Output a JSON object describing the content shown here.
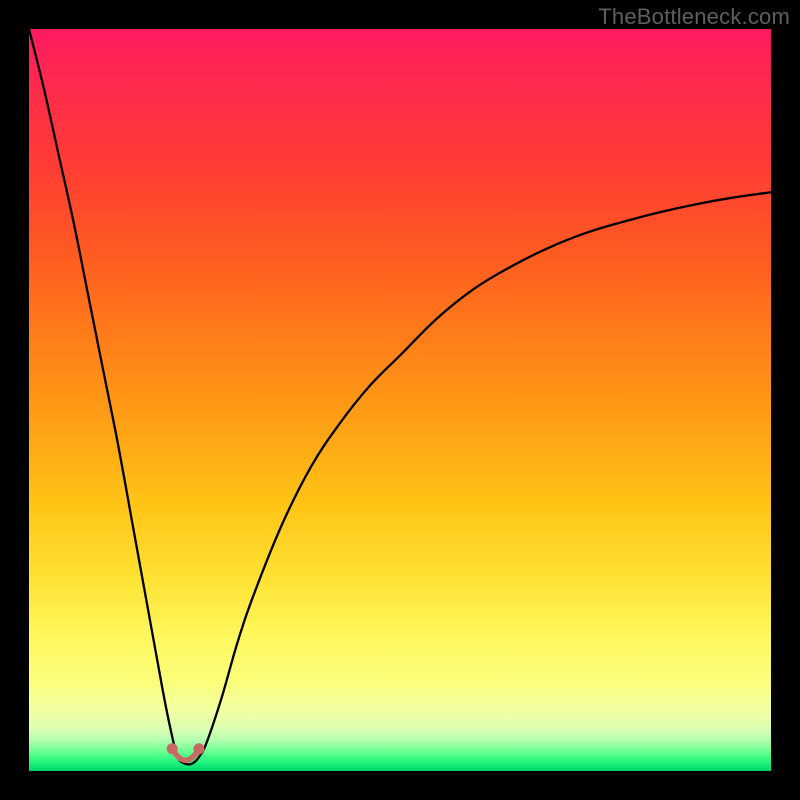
{
  "attribution": "TheBottleneck.com",
  "colors": {
    "frame": "#000000",
    "curve": "#000000",
    "bump": "#c86a63",
    "gradient_top": "#ff1a61",
    "gradient_bottom": "#00d46a"
  },
  "chart_data": {
    "type": "line",
    "title": "",
    "xlabel": "",
    "ylabel": "",
    "xlim": [
      0,
      100
    ],
    "ylim": [
      0,
      100
    ],
    "notes": "Bottleneck-style curve. y is bottleneck percentage (0 = green/good, 100 = red/bad). x is a normalized hardware-balance axis. Minimum (~0) occurs near x≈21 and the curve rises steeply on both sides, asymptoting near 100 on the left edge and ~78 on the right edge.",
    "series": [
      {
        "name": "bottleneck-curve",
        "x": [
          0,
          2,
          4,
          6,
          8,
          10,
          12,
          14,
          16,
          18,
          19,
          20,
          21,
          22,
          23,
          24,
          26,
          28,
          30,
          34,
          38,
          42,
          46,
          50,
          55,
          60,
          65,
          70,
          75,
          80,
          85,
          90,
          95,
          100
        ],
        "values": [
          100,
          92,
          83,
          74,
          64,
          54,
          44,
          33,
          22,
          11,
          6,
          2,
          1,
          1,
          2,
          4,
          10,
          17,
          23,
          33,
          41,
          47,
          52,
          56,
          61,
          65,
          68,
          70.5,
          72.5,
          74,
          75.3,
          76.4,
          77.3,
          78
        ]
      }
    ],
    "bump": {
      "note": "small salmon U-shaped marker at the curve minimum",
      "left_dot_x": 19.3,
      "right_dot_x": 22.9,
      "dot_y": 3.0,
      "arc_bottom_y": 0.7
    }
  }
}
